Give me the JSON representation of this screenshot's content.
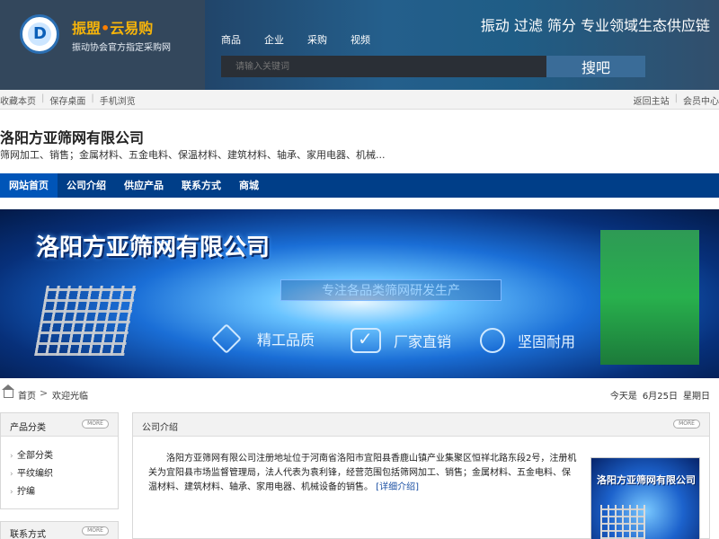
{
  "header": {
    "brand_title_part1": "振盟",
    "brand_title_dot": "•",
    "brand_title_part2": "云易购",
    "brand_subtitle": "振动协会官方指定采购网",
    "headline": "振动 过滤 筛分 专业领域生态供应链",
    "nav": [
      "商品",
      "企业",
      "采购",
      "视频"
    ],
    "search_placeholder": "请输入关键词",
    "search_button": "搜吧"
  },
  "util_bar": {
    "left": [
      "收藏本页",
      "保存桌面",
      "手机浏览"
    ],
    "right": [
      "返回主站",
      "会员中心"
    ]
  },
  "company": {
    "name": "洛阳方亚筛网有限公司",
    "scope": "筛网加工、销售；金属材料、五金电料、保温材料、建筑材料、轴承、家用电器、机械..."
  },
  "main_nav": {
    "items": [
      "网站首页",
      "公司介绍",
      "供应产品",
      "联系方式",
      "商城"
    ],
    "active_index": 0
  },
  "banner": {
    "title": "洛阳方亚筛网有限公司",
    "slogan": "专注各品类筛网研发生产",
    "features": [
      "精工品质",
      "厂家直销",
      "坚固耐用"
    ]
  },
  "breadcrumb": {
    "home": "首页",
    "current": "欢迎光临",
    "date_prefix": "今天是",
    "date": "6月25日",
    "weekday": "星期日"
  },
  "sidebar": {
    "categories_title": "产品分类",
    "more_label": "MORE",
    "categories": [
      "全部分类",
      "平纹编织",
      "拧编"
    ],
    "contact_title": "联系方式"
  },
  "content": {
    "title": "公司介绍",
    "more_label": "MORE",
    "intro": "洛阳方亚筛网有限公司注册地址位于河南省洛阳市宜阳县香鹿山镇产业集聚区恒祥北路东段2号，注册机关为宜阳县市场监督管理局，法人代表为袁利锋，经营范围包括筛网加工、销售；金属材料、五金电料、保温材料、建筑材料、轴承、家用电器、机械设备的销售。",
    "read_more": "[详细介绍]",
    "thumb_title": "洛阳方亚筛网有限公司"
  },
  "colors": {
    "nav_bg": "#003e88",
    "nav_active": "#0055b8",
    "brand_orange": "#f6b40a",
    "link_blue": "#1a4fa3"
  }
}
